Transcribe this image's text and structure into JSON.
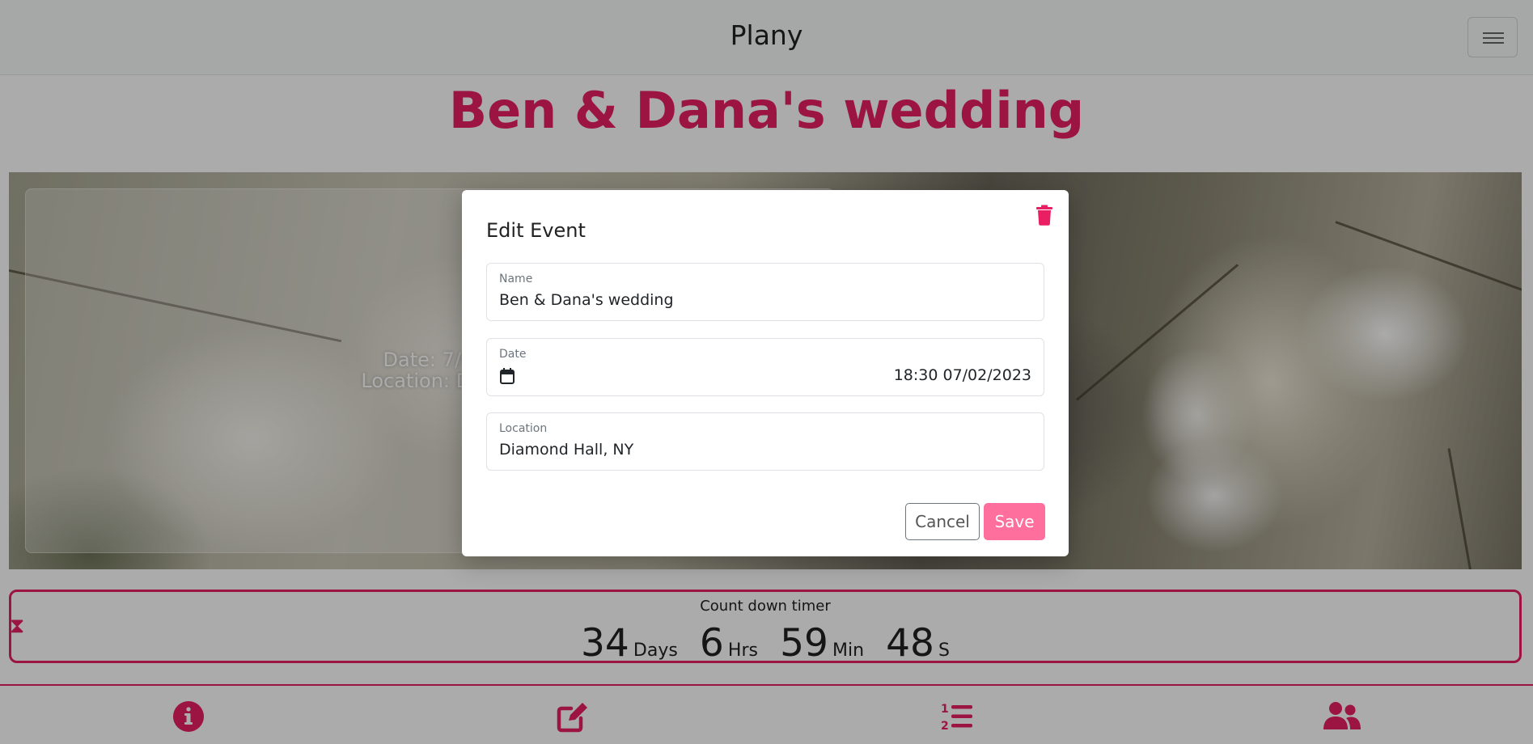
{
  "navbar": {
    "brand": "Plany",
    "menu_icon": "hamburger-menu-icon"
  },
  "event": {
    "title": "Ben & Dana's wedding",
    "date_line": "Date: 7/02/2023 18:30",
    "location_line": "Location: Diamond Hall, NY"
  },
  "countdown": {
    "label": "Count down timer",
    "days": "34",
    "days_unit": "Days",
    "hours": "6",
    "hours_unit": "Hrs",
    "minutes": "59",
    "minutes_unit": "Min",
    "seconds": "48",
    "seconds_unit": "S",
    "icon": "hourglass-icon"
  },
  "bottom_nav": {
    "items": [
      {
        "icon": "info-icon"
      },
      {
        "icon": "edit-icon"
      },
      {
        "icon": "ordered-list-icon"
      },
      {
        "icon": "users-icon"
      }
    ]
  },
  "modal": {
    "title": "Edit Event",
    "delete_icon": "trash-icon",
    "name_label": "Name",
    "name_value": "Ben & Dana's wedding",
    "date_label": "Date",
    "date_value": "18:30 07/02/2023",
    "location_label": "Location",
    "location_value": "Diamond Hall, NY",
    "cancel_label": "Cancel",
    "save_label": "Save"
  },
  "colors": {
    "accent": "#e91e63",
    "save_button": "#ff6f9e"
  }
}
